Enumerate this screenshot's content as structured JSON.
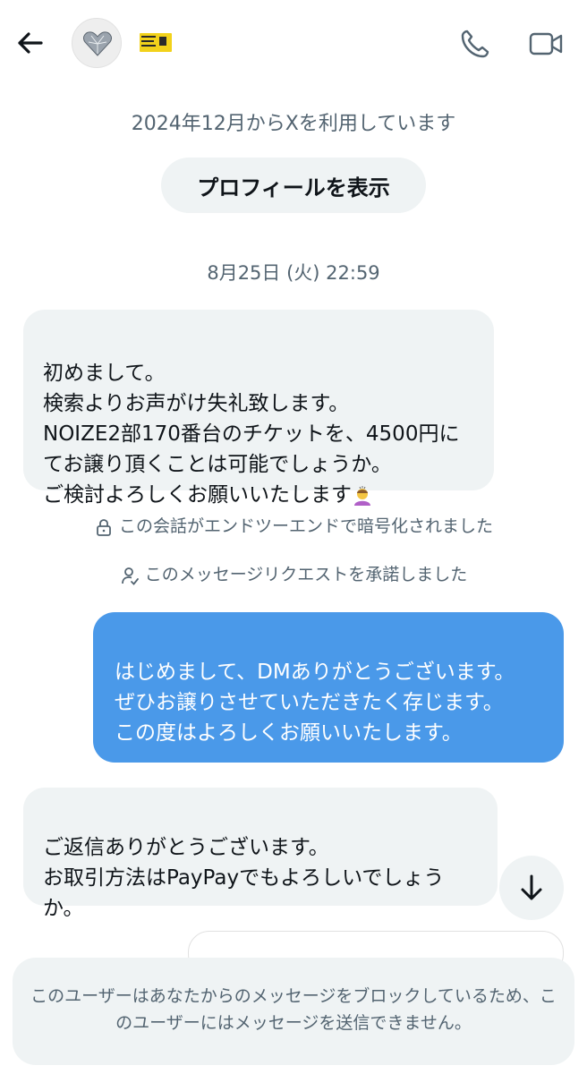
{
  "header": {
    "back_icon": "arrow-left-icon",
    "avatar_icon": "heart-gem-icon",
    "name_badge_icon": "concert-ticket-icon",
    "call_icon": "phone-icon",
    "video_icon": "video-camera-icon"
  },
  "intro": {
    "since_text": "2024年12月からXを利用しています",
    "profile_button_label": "プロフィールを表示",
    "date_label": "8月25日 (火) 22:59"
  },
  "messages": [
    {
      "side": "received",
      "text": "初めまして。\n検索よりお声がけ失礼致します。\nNOIZE2部170番台のチケットを、4500円にてお譲り頂くことは可能でしょうか。\nご検討よろしくお願いいたします",
      "emoji": "person-bowing-emoji"
    },
    {
      "side": "sent",
      "text": "はじめまして、DMありがとうございます。\nぜひお譲りさせていただきたく存じます。\nこの度はよろしくお願いいたします。"
    },
    {
      "side": "received",
      "text": "ご返信ありがとうございます。\nお取引方法はPayPayでもよろしいでしょうか。"
    }
  ],
  "system": {
    "encrypted_text": "この会話がエンドツーエンドで暗号化されました",
    "encrypted_icon": "lock-icon",
    "request_text": "このメッセージリクエストを承諾しました",
    "request_icon": "person-check-icon"
  },
  "scroll_icon": "arrow-down-icon",
  "blocked_notice": "このユーザーはあなたからのメッセージをブロックしているため、このユーザーにはメッセージを送信できません。",
  "colors": {
    "sent_bubble": "#4a99e9",
    "received_bubble": "#eff3f4",
    "muted_text": "#536471"
  }
}
